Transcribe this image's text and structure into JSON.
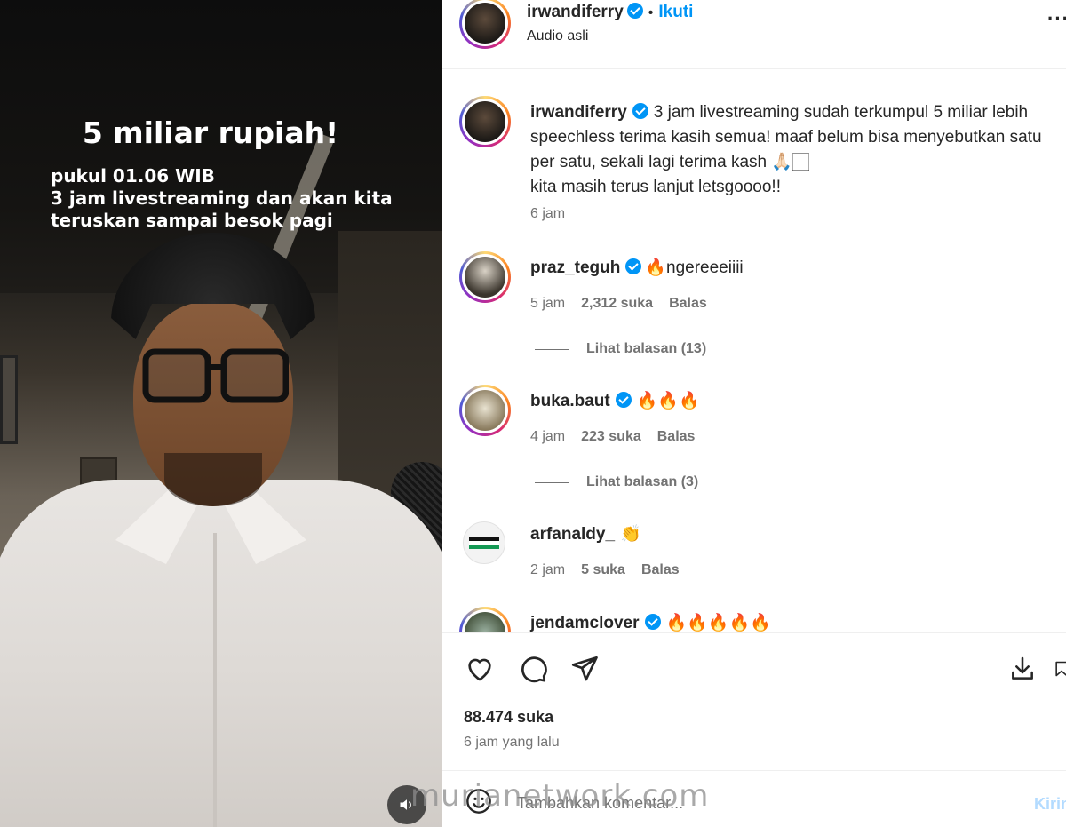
{
  "video": {
    "overlay_title": "5 miliar rupiah!",
    "overlay_line1": "pukul 01.06 WIB",
    "overlay_line2": "3 jam livestreaming dan akan kita",
    "overlay_line3": "teruskan sampai besok pagi",
    "sound_icon": "speaker-icon"
  },
  "header": {
    "username": "irwandiferry",
    "separator": "•",
    "follow_label": "Ikuti",
    "audio_label": "Audio asli",
    "more_label": "···"
  },
  "caption": {
    "username": "irwandiferry",
    "line1": "3 jam livestreaming sudah terkumpul 5 miliar lebih",
    "line2": "speechless terima kasih semua! maaf belum bisa menyebutkan satu",
    "line3": "per satu, sekali lagi terima kash 🙏🏻🏻",
    "line4": "kita masih terus lanjut letsgoooo!!",
    "time": "6 jam"
  },
  "comments": [
    {
      "username": "praz_teguh",
      "verified": true,
      "text": "🔥ngereeeiiii",
      "time": "5 jam",
      "likes": "2,312 suka",
      "reply": "Balas",
      "view_replies": "Lihat balasan (13)"
    },
    {
      "username": "buka.baut",
      "verified": true,
      "text": "🔥🔥🔥",
      "time": "4 jam",
      "likes": "223 suka",
      "reply": "Balas",
      "view_replies": "Lihat balasan (3)"
    },
    {
      "username": "arfanaldy_",
      "verified": false,
      "text": "👏",
      "time": "2 jam",
      "likes": "5 suka",
      "reply": "Balas"
    },
    {
      "username": "jendamclover",
      "verified": true,
      "text": "🔥🔥🔥🔥🔥"
    }
  ],
  "actions": {
    "icons": [
      "heart-icon",
      "comment-icon",
      "share-icon",
      "download-icon",
      "bookmark-icon"
    ],
    "likes_count": "88.474 suka",
    "posted_time": "6 jam yang lalu",
    "comment_placeholder": "Tambahkan komentar...",
    "send_label": "Kirim"
  },
  "watermark": "murianetwork.com",
  "colors": {
    "accent": "#0095f6",
    "text": "#262626",
    "muted": "#737373",
    "send_disabled": "#b3dbff"
  }
}
